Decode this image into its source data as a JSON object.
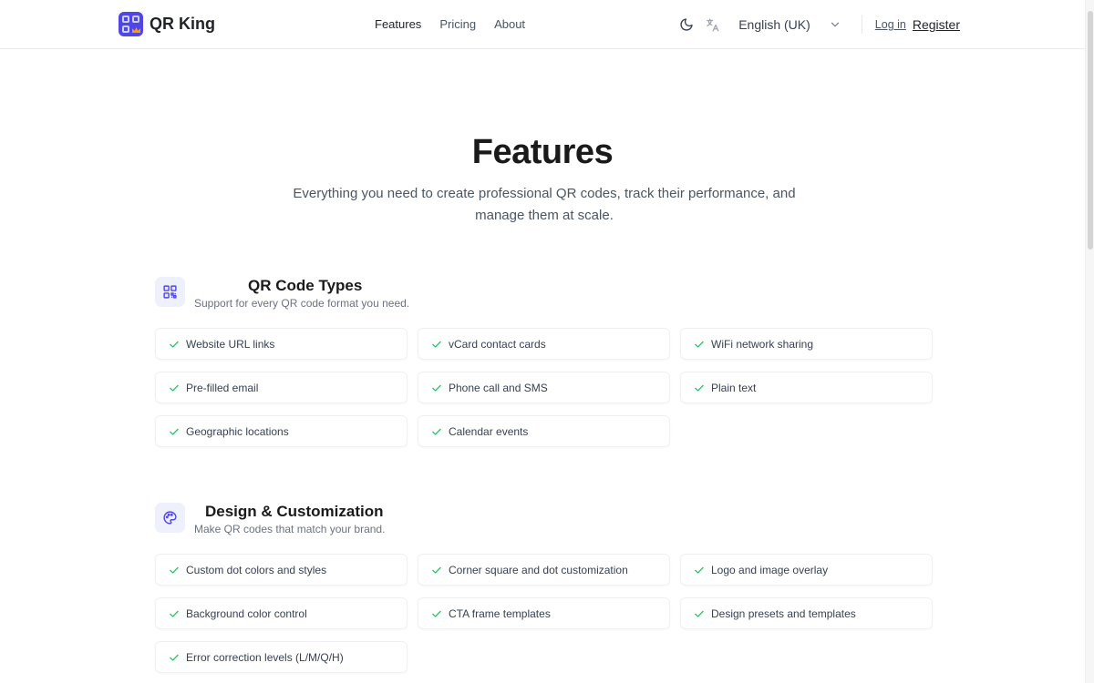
{
  "header": {
    "app_name": "QR King",
    "nav": [
      {
        "label": "Features"
      },
      {
        "label": "Pricing"
      },
      {
        "label": "About"
      }
    ],
    "language": "English (UK)",
    "login_label": "Log in",
    "register_label": "Register",
    "icons": {
      "theme": "moon-icon",
      "translate": "translate-icon",
      "dropdown": "chevron-down-icon"
    }
  },
  "hero": {
    "title": "Features",
    "subtitle": "Everything you need to create professional QR codes, track their performance, and manage them at scale."
  },
  "sections": [
    {
      "title": "QR Code Types",
      "description": "Support for every QR code format you need.",
      "icon": "qr-code-icon",
      "items": [
        {
          "label": "Website URL links"
        },
        {
          "label": "vCard contact cards"
        },
        {
          "label": "WiFi network sharing"
        },
        {
          "label": "Pre-filled email"
        },
        {
          "label": "Phone call and SMS"
        },
        {
          "label": "Plain text"
        },
        {
          "label": "Geographic locations"
        },
        {
          "label": "Calendar events"
        }
      ]
    },
    {
      "title": "Design & Customization",
      "description": "Make QR codes that match your brand.",
      "icon": "palette-icon",
      "items": [
        {
          "label": "Custom dot colors and styles"
        },
        {
          "label": "Corner square and dot customization"
        },
        {
          "label": "Logo and image overlay"
        },
        {
          "label": "Background color control"
        },
        {
          "label": "CTA frame templates"
        },
        {
          "label": "Design presets and templates"
        },
        {
          "label": "Error correction levels (L/M/Q/H)"
        }
      ]
    }
  ],
  "colors": {
    "brand": "#4f46e5",
    "check": "#22c55e",
    "icon_bg": "#eef0fb"
  }
}
